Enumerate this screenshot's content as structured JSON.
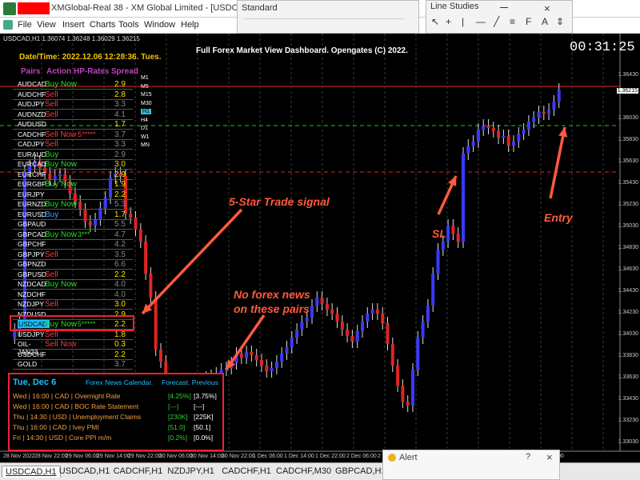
{
  "window": {
    "title": "XMGlobal-Real 38 - XM Global Limited - [USDCAD,H1]"
  },
  "menu": [
    "File",
    "View",
    "Insert",
    "Charts",
    "Tools",
    "Window",
    "Help"
  ],
  "standard_panel": {
    "title": "Standard"
  },
  "line_studies_panel": {
    "title": "Line Studies"
  },
  "chart_info": "USDCAD,H1  1.36074 1.36248 1.36029 1.36215",
  "dashboard_title": "Full Forex Market View Dashboard. Opengates (C) 2022.",
  "timer": "00:31:25",
  "datetime": "Date/Time: 2022.12.06 12:28:36. Tues.",
  "headers": {
    "pairs": "Pairs",
    "action": "Action",
    "rates": "HP-Rates",
    "spread": "Spread"
  },
  "timeframes": [
    "M1",
    "M5",
    "M15",
    "M30",
    "H1",
    "H4",
    "D1",
    "W1",
    "MN"
  ],
  "pairs": [
    {
      "name": "AUDCAD",
      "action": "Buy Now",
      "action_color": "#21e021",
      "stars": "",
      "spread": "2.9",
      "spread_color": "#f7e000"
    },
    {
      "name": "AUDCHF",
      "action": "Sell",
      "action_color": "#ff3a3a",
      "stars": "",
      "spread": "2.8",
      "spread_color": "#f7e000"
    },
    {
      "name": "AUDJPY",
      "action": "Sell",
      "action_color": "#ff3a3a",
      "stars": "",
      "spread": "3.3",
      "spread_color": "#888888"
    },
    {
      "name": "AUDNZD",
      "action": "Sell",
      "action_color": "#ff3a3a",
      "stars": "",
      "spread": "4.1",
      "spread_color": "#888888"
    },
    {
      "name": "AUDUSD",
      "action": "",
      "action_color": "#ffffff",
      "stars": "",
      "spread": "1.7",
      "spread_color": "#f7e000"
    },
    {
      "name": "CADCHF",
      "action": "Sell Now",
      "action_color": "#ff3a3a",
      "stars": "5*****",
      "spread": "3.7",
      "spread_color": "#888888"
    },
    {
      "name": "CADJPY",
      "action": "Sell",
      "action_color": "#ff3a3a",
      "stars": "",
      "spread": "3.3",
      "spread_color": "#888888"
    },
    {
      "name": "EURAUD",
      "action": "Buy",
      "action_color": "#21e021",
      "stars": "",
      "spread": "2.9",
      "spread_color": "#888888"
    },
    {
      "name": "EURCAD",
      "action": "Buy Now",
      "action_color": "#21e021",
      "stars": "",
      "spread": "3.0",
      "spread_color": "#f7e000"
    },
    {
      "name": "EURCHF",
      "action": "",
      "action_color": "#ffffff",
      "stars": "",
      "spread": "2.9",
      "spread_color": "#f7e000"
    },
    {
      "name": "EURGBP",
      "action": "Buy Now",
      "action_color": "#21e021",
      "stars": "",
      "spread": "1.9",
      "spread_color": "#f7e000"
    },
    {
      "name": "EURJPY",
      "action": "",
      "action_color": "#ffffff",
      "stars": "",
      "spread": "2.2",
      "spread_color": "#f7e000"
    },
    {
      "name": "EURNZD",
      "action": "Buy Now",
      "action_color": "#21e021",
      "stars": "",
      "spread": "5.3",
      "spread_color": "#888888"
    },
    {
      "name": "EURUSD",
      "action": "Buy",
      "action_color": "#3aa5ff",
      "stars": "",
      "spread": "1.7",
      "spread_color": "#f7e000"
    },
    {
      "name": "GBPAUD",
      "action": "",
      "action_color": "#ffffff",
      "stars": "",
      "spread": "5.5",
      "spread_color": "#888888"
    },
    {
      "name": "GBPCAD",
      "action": "Buy Now",
      "action_color": "#21e021",
      "stars": "3***",
      "spread": "4.7",
      "spread_color": "#888888"
    },
    {
      "name": "GBPCHF",
      "action": "",
      "action_color": "#ffffff",
      "stars": "",
      "spread": "4.2",
      "spread_color": "#888888"
    },
    {
      "name": "GBPJPY",
      "action": "Sell",
      "action_color": "#ff3a3a",
      "stars": "",
      "spread": "3.5",
      "spread_color": "#888888"
    },
    {
      "name": "GBPNZD",
      "action": "",
      "action_color": "#ffffff",
      "stars": "",
      "spread": "6.6",
      "spread_color": "#888888"
    },
    {
      "name": "GBPUSD",
      "action": "Sell",
      "action_color": "#ff3a3a",
      "stars": "",
      "spread": "2.2",
      "spread_color": "#f7e000"
    },
    {
      "name": "NZDCAD",
      "action": "Buy Now",
      "action_color": "#21e021",
      "stars": "",
      "spread": "4.0",
      "spread_color": "#888888"
    },
    {
      "name": "NZDCHF",
      "action": "",
      "action_color": "#ffffff",
      "stars": "",
      "spread": "4.0",
      "spread_color": "#888888"
    },
    {
      "name": "NZDJPY",
      "action": "Sell",
      "action_color": "#ff3a3a",
      "stars": "",
      "spread": "3.0",
      "spread_color": "#f7e000"
    },
    {
      "name": "NZDUSD",
      "action": "",
      "action_color": "#ffffff",
      "stars": "",
      "spread": "2.9",
      "spread_color": "#f7e000"
    },
    {
      "name": "USDCAD",
      "action": "Buy Now",
      "action_color": "#21e021",
      "stars": "5*****",
      "spread": "2.2",
      "spread_color": "#f7e000",
      "highlight": true
    },
    {
      "name": "USDJPY",
      "action": "Sell",
      "action_color": "#ff3a3a",
      "stars": "",
      "spread": "1.8",
      "spread_color": "#f7e000"
    },
    {
      "name": "OIL-JAN23",
      "action": "Sell Now",
      "action_color": "#ff3a3a",
      "stars": "",
      "spread": "0.3",
      "spread_color": "#f7e000"
    },
    {
      "name": "USDCHF",
      "action": "",
      "action_color": "#ffffff",
      "stars": "",
      "spread": "2.2",
      "spread_color": "#f7e000"
    },
    {
      "name": "GOLD",
      "action": "",
      "action_color": "#ffffff",
      "stars": "",
      "spread": "3.7",
      "spread_color": "#888888"
    }
  ],
  "news": {
    "date": "Tue, Dec 6",
    "calendar_label": "Forex News Calendar.",
    "forecast_label": "Forecast.  Previous",
    "rows": [
      {
        "text": "Wed | 16:00 | CAD | Overnight Rate",
        "forecast": "[4.25%]",
        "previous": "[3.75%]"
      },
      {
        "text": "Wed | 16:00 | CAD | BOC Rate Statement",
        "forecast": "[---]",
        "previous": "[---]"
      },
      {
        "text": "Thu | 14:30 | USD | Unemployment Claims",
        "forecast": "[230K]",
        "previous": "[225K]"
      },
      {
        "text": "Thu | 16:00 | CAD | Ivey PMI",
        "forecast": "[51.0]",
        "previous": "[50.1]"
      },
      {
        "text": "Fri | 14:30 | USD | Core PPI m/m",
        "forecast": "[0.2%]",
        "previous": "[0.0%]"
      }
    ]
  },
  "annotations": {
    "signal": "5-Star Trade signal",
    "news_line1": "No forex news",
    "news_line2": "on these pairs",
    "sl": "SL",
    "entry": "Entry"
  },
  "price_axis": [
    "1.36430",
    "1.36215",
    "1.36030",
    "1.35830",
    "1.35630",
    "1.35430",
    "1.35230",
    "1.35030",
    "1.34830",
    "1.34630",
    "1.34430",
    "1.34230",
    "1.34030",
    "1.33830",
    "1.33630",
    "1.33430",
    "1.33230",
    "1.33030"
  ],
  "current_price": "1.36215",
  "time_axis": [
    "28 Nov 2022",
    "28 Nov 22:00",
    "29 Nov 06:00",
    "29 Nov 14:00",
    "29 Nov 22:00",
    "30 Nov 06:00",
    "30 Nov 14:00",
    "30 Nov 22:00",
    "1 Dec 06:00",
    "1 Dec 14:00",
    "1 Dec 22:00",
    "2 Dec 06:00",
    "2 Dec 14:00",
    "2 Dec 22:00",
    "5 Dec 06:00",
    "5 Dec 14:00",
    "5 Dec 22:00",
    "6 Dec 06:00"
  ],
  "tabs": [
    "USDCAD,H1",
    "USDCAD,H1",
    "CADCHF,H1",
    "NZDJPY,H1",
    "CADCHF,H1",
    "CADCHF,M30",
    "GBPCAD,H1",
    "EURCAD,H1"
  ],
  "alert_panel": {
    "title": "Alert",
    "buttons": [
      "?",
      "×"
    ]
  },
  "colors": {
    "accent": "#ff5a3c",
    "buy": "#21e021",
    "sell": "#ff3a3a",
    "bull_candle": "#3a3aff",
    "bear_candle": "#e02424"
  }
}
